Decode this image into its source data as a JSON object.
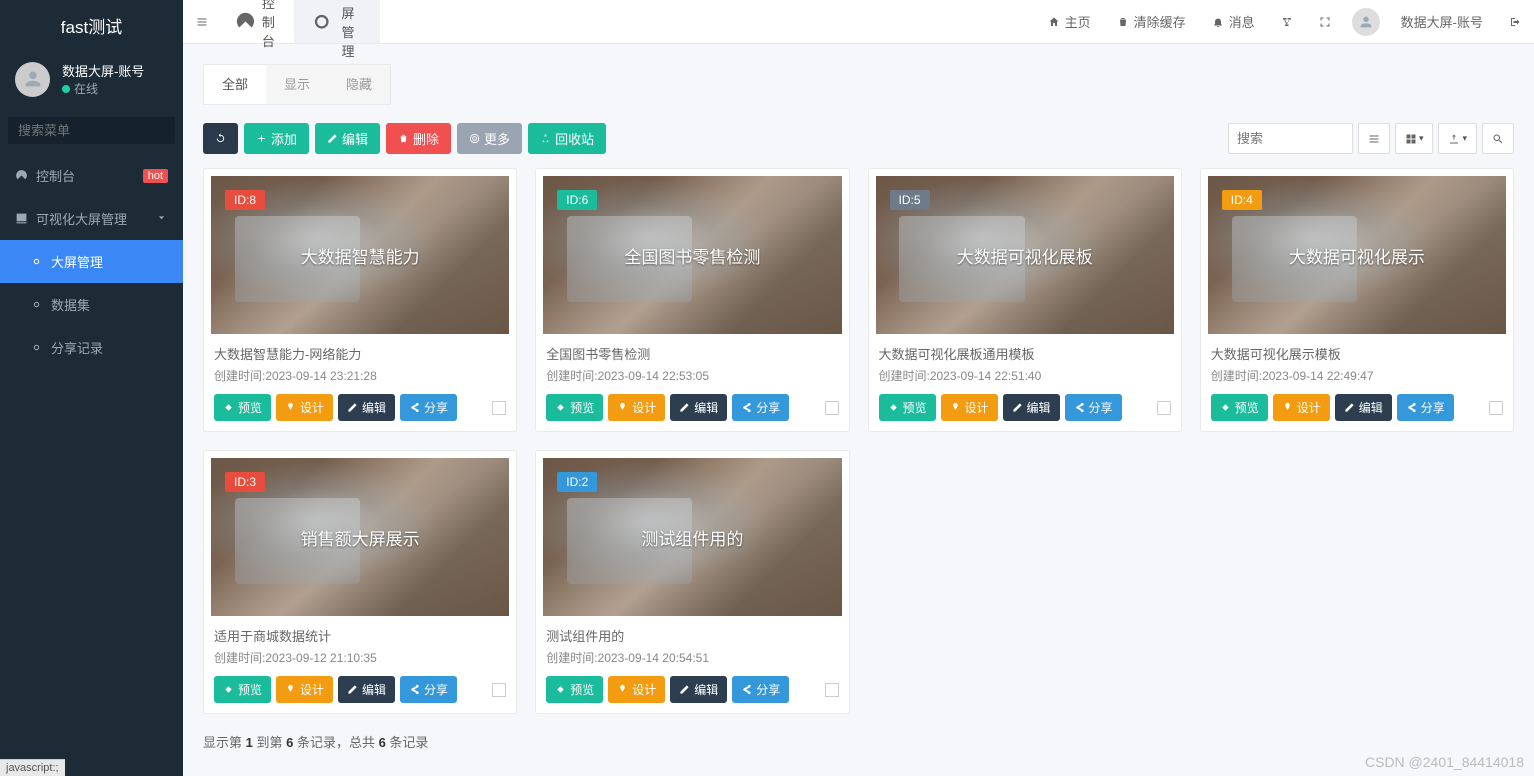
{
  "app": {
    "logo": "fast测试"
  },
  "user": {
    "name": "数据大屏-账号",
    "status": "在线"
  },
  "sidebar": {
    "search_placeholder": "搜索菜单",
    "items": [
      {
        "label": "控制台",
        "badge": "hot"
      },
      {
        "label": "可视化大屏管理"
      },
      {
        "label": "大屏管理"
      },
      {
        "label": "数据集"
      },
      {
        "label": "分享记录"
      }
    ]
  },
  "topbar": {
    "tabs": [
      {
        "label": "控制台"
      },
      {
        "label": "大屏管理"
      }
    ],
    "right": {
      "home": "主页",
      "clear": "清除缓存",
      "message": "消息",
      "username": "数据大屏-账号"
    }
  },
  "filter_tabs": [
    "全部",
    "显示",
    "隐藏"
  ],
  "toolbar": {
    "add": "添加",
    "edit": "编辑",
    "delete": "删除",
    "more": "更多",
    "recycle": "回收站",
    "search_placeholder": "搜索"
  },
  "card_buttons": {
    "preview": "预览",
    "design": "设计",
    "edit": "编辑",
    "share": "分享"
  },
  "cards": [
    {
      "id": "ID:8",
      "badge": "badge-red",
      "overlay": "大数据智慧能力",
      "title": "大数据智慧能力-网络能力",
      "time": "创建时间:2023-09-14 23:21:28"
    },
    {
      "id": "ID:6",
      "badge": "badge-teal",
      "overlay": "全国图书零售检测",
      "title": "全国图书零售检测",
      "time": "创建时间:2023-09-14 22:53:05"
    },
    {
      "id": "ID:5",
      "badge": "badge-slate",
      "overlay": "大数据可视化展板",
      "title": "大数据可视化展板通用模板",
      "time": "创建时间:2023-09-14 22:51:40"
    },
    {
      "id": "ID:4",
      "badge": "badge-orange",
      "overlay": "大数据可视化展示",
      "title": "大数据可视化展示模板",
      "time": "创建时间:2023-09-14 22:49:47"
    },
    {
      "id": "ID:3",
      "badge": "badge-red",
      "overlay": "销售额大屏展示",
      "title": "适用于商城数据统计",
      "time": "创建时间:2023-09-12 21:10:35"
    },
    {
      "id": "ID:2",
      "badge": "badge-blue",
      "overlay": "测试组件用的",
      "title": "测试组件用的",
      "time": "创建时间:2023-09-14 20:54:51"
    }
  ],
  "pager": {
    "pre": "显示第 ",
    "from": "1",
    "mid": " 到第 ",
    "to": "6",
    "mid2": " 条记录，总共 ",
    "total": "6",
    "suf": " 条记录"
  },
  "watermark": "CSDN @2401_84414018",
  "statusbar": "javascript:;"
}
